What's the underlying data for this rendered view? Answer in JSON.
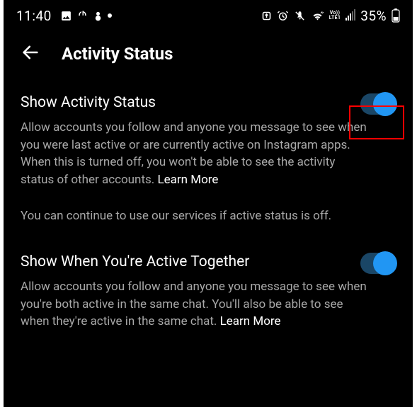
{
  "statusbar": {
    "time": "11:40",
    "battery": "35%"
  },
  "header": {
    "title": "Activity Status"
  },
  "settings": {
    "activity": {
      "title": "Show Activity Status",
      "desc_part1": "Allow accounts you follow and anyone you message to see when you were last active or are currently active on Instagram apps. When this is turned off, you won't be able to see the activity status of other accounts. ",
      "learn_more": "Learn More",
      "note": "You can continue to use our services if active status is off."
    },
    "together": {
      "title": "Show When You're Active Together",
      "desc_part1": "Allow accounts you follow and anyone you message to see when you're both active in the same chat. You'll also be able to see when they're active in the same chat. ",
      "learn_more": "Learn More"
    }
  }
}
